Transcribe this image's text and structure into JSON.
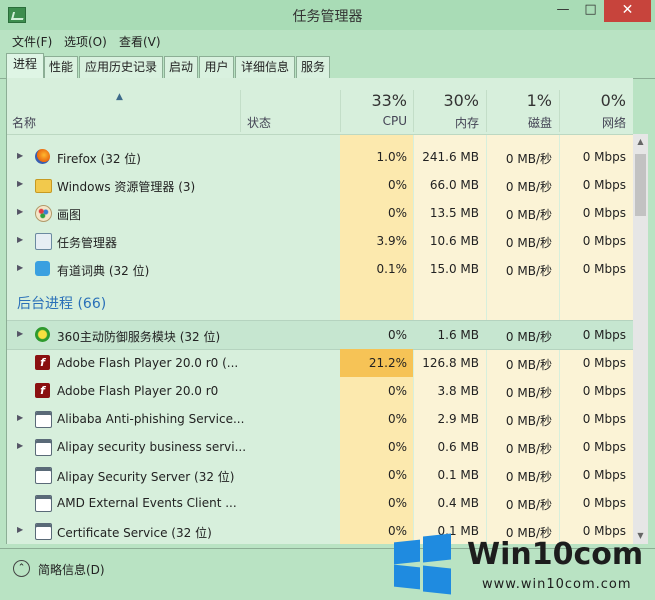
{
  "window": {
    "title": "任务管理器",
    "minimize_glyph": "—",
    "maximize_glyph": "□",
    "close_glyph": "✕"
  },
  "menu": [
    "文件(F)",
    "选项(O)",
    "查看(V)"
  ],
  "tabs": [
    "进程",
    "性能",
    "应用历史记录",
    "启动",
    "用户",
    "详细信息",
    "服务"
  ],
  "active_tab": "进程",
  "columns": {
    "name": "名称",
    "status": "状态",
    "cpu": {
      "percent": "33%",
      "label": "CPU"
    },
    "memory": {
      "percent": "30%",
      "label": "内存"
    },
    "disk": {
      "percent": "1%",
      "label": "磁盘"
    },
    "network": {
      "percent": "0%",
      "label": "网络"
    }
  },
  "apps": [
    {
      "name": "Firefox (32 位)",
      "icon": "firefox-icon",
      "cpu": "1.0%",
      "mem": "241.6 MB",
      "disk": "0 MB/秒",
      "net": "0 Mbps"
    },
    {
      "name": "Windows 资源管理器 (3)",
      "icon": "explorer-icon",
      "cpu": "0%",
      "mem": "66.0 MB",
      "disk": "0 MB/秒",
      "net": "0 Mbps"
    },
    {
      "name": "画图",
      "icon": "paint-icon",
      "cpu": "0%",
      "mem": "13.5 MB",
      "disk": "0 MB/秒",
      "net": "0 Mbps"
    },
    {
      "name": "任务管理器",
      "icon": "task-manager-icon",
      "cpu": "3.9%",
      "mem": "10.6 MB",
      "disk": "0 MB/秒",
      "net": "0 Mbps"
    },
    {
      "name": "有道词典 (32 位)",
      "icon": "youdao-icon",
      "cpu": "0.1%",
      "mem": "15.0 MB",
      "disk": "0 MB/秒",
      "net": "0 Mbps"
    }
  ],
  "background_group": {
    "title": "后台进程 (66)"
  },
  "background": [
    {
      "name": "360主动防御服务模块 (32 位)",
      "icon": "360-icon",
      "cpu": "0%",
      "mem": "1.6 MB",
      "disk": "0 MB/秒",
      "net": "0 Mbps"
    },
    {
      "name": "Adobe Flash Player 20.0 r0 (...",
      "icon": "flash-icon",
      "cpu": "21.2%",
      "mem": "126.8 MB",
      "disk": "0 MB/秒",
      "net": "0 Mbps"
    },
    {
      "name": "Adobe Flash Player 20.0 r0",
      "icon": "flash-icon",
      "cpu": "0%",
      "mem": "3.8 MB",
      "disk": "0 MB/秒",
      "net": "0 Mbps"
    },
    {
      "name": "Alibaba Anti-phishing Service...",
      "icon": "service-icon",
      "cpu": "0%",
      "mem": "2.9 MB",
      "disk": "0 MB/秒",
      "net": "0 Mbps"
    },
    {
      "name": "Alipay security business servi...",
      "icon": "service-icon",
      "cpu": "0%",
      "mem": "0.6 MB",
      "disk": "0 MB/秒",
      "net": "0 Mbps"
    },
    {
      "name": "Alipay Security Server (32 位)",
      "icon": "service-icon",
      "cpu": "0%",
      "mem": "0.1 MB",
      "disk": "0 MB/秒",
      "net": "0 Mbps"
    },
    {
      "name": "AMD External Events Client ...",
      "icon": "service-icon",
      "cpu": "0%",
      "mem": "0.4 MB",
      "disk": "0 MB/秒",
      "net": "0 Mbps"
    },
    {
      "name": "Certificate Service (32 位)",
      "icon": "service-icon",
      "cpu": "0%",
      "mem": "0.1 MB",
      "disk": "0 MB/秒",
      "net": "0 Mbps"
    }
  ],
  "footer": {
    "fewer_details": "简略信息(D)"
  },
  "watermark": {
    "title": "Win10com",
    "url": "www.win10com.com"
  },
  "colors": {
    "cpu_hot": "#f6c356",
    "heat": "#fce9ae",
    "group_title": "#2a70b8",
    "background": "#b9e3c3"
  }
}
